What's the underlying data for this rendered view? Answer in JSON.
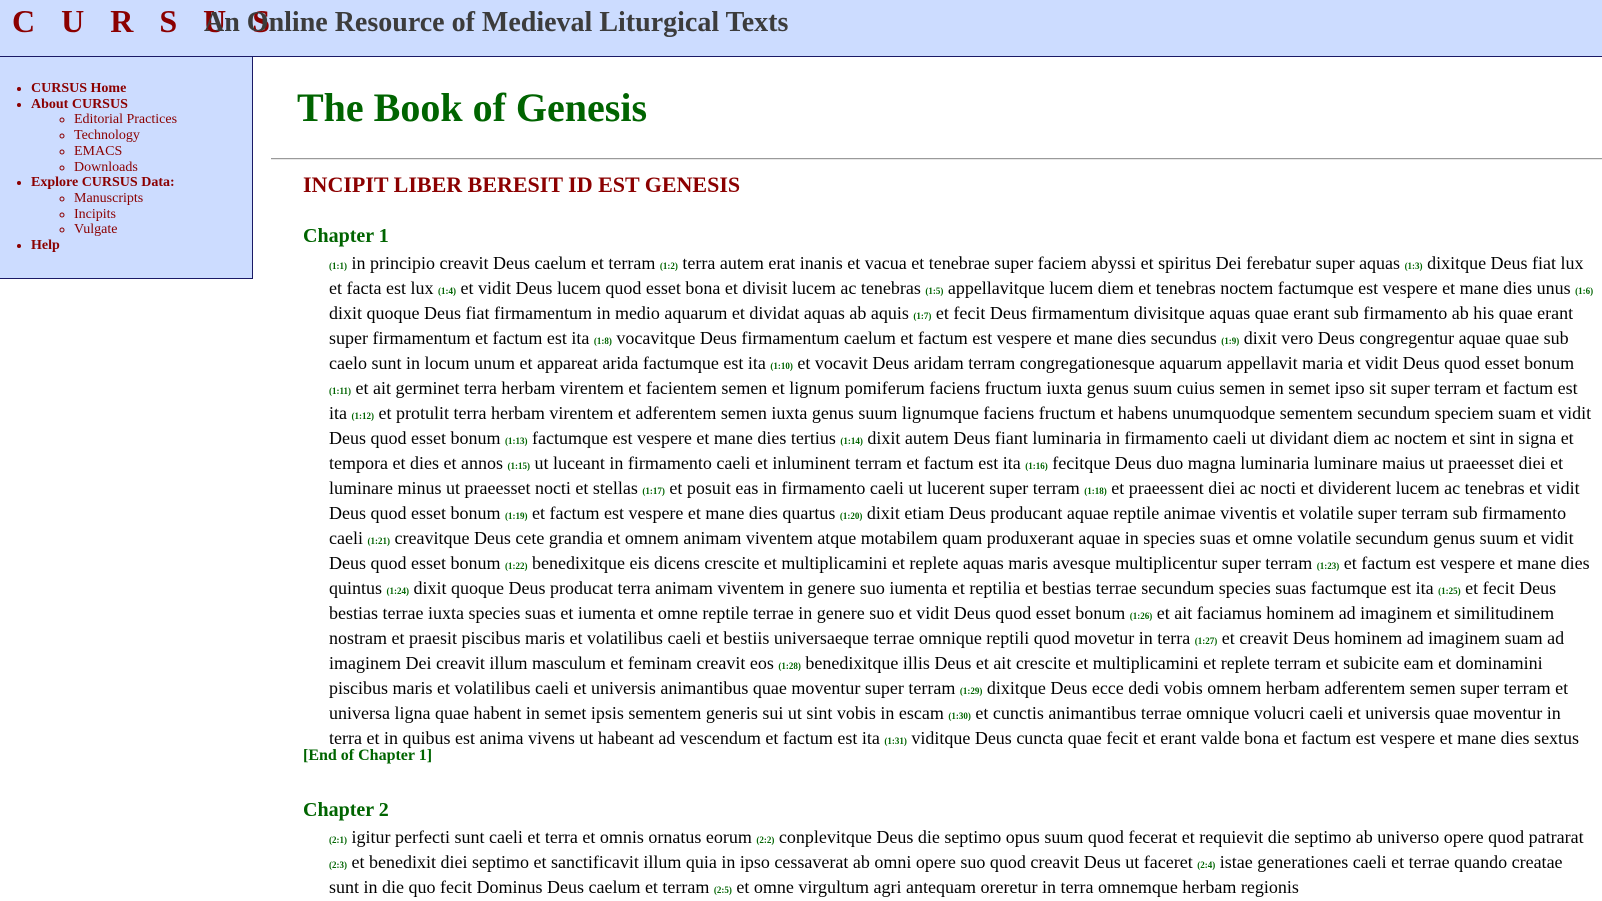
{
  "header": {
    "brand": "C U R S U S",
    "subtitle": "An Online Resource of Medieval Liturgical Texts"
  },
  "sidebar": {
    "items": [
      {
        "label": "CURSUS Home"
      },
      {
        "label": "About CURSUS",
        "children": [
          "Editorial Practices",
          "Technology",
          "EMACS",
          "Downloads"
        ]
      },
      {
        "label": "Explore CURSUS Data:",
        "children": [
          "Manuscripts",
          "Incipits",
          "Vulgate"
        ]
      },
      {
        "label": "Help"
      }
    ]
  },
  "page": {
    "title": "The Book of Genesis",
    "incipit": "INCIPIT LIBER BERESIT ID EST GENESIS"
  },
  "chapters": [
    {
      "heading": "Chapter 1",
      "end_label": "[End of Chapter 1]",
      "verses": [
        {
          "n": "(1:1)",
          "t": "in principio creavit Deus caelum et terram"
        },
        {
          "n": "(1:2)",
          "t": "terra autem erat inanis et vacua et tenebrae super faciem abyssi et spiritus Dei ferebatur super aquas"
        },
        {
          "n": "(1:3)",
          "t": "dixitque Deus fiat lux et facta est lux"
        },
        {
          "n": "(1:4)",
          "t": "et vidit Deus lucem quod esset bona et divisit lucem ac tenebras"
        },
        {
          "n": "(1:5)",
          "t": "appellavitque lucem diem et tenebras noctem factumque est vespere et mane dies unus"
        },
        {
          "n": "(1:6)",
          "t": "dixit quoque Deus fiat firmamentum in medio aquarum et dividat aquas ab aquis"
        },
        {
          "n": "(1:7)",
          "t": "et fecit Deus firmamentum divisitque aquas quae erant sub firmamento ab his quae erant super firmamentum et factum est ita"
        },
        {
          "n": "(1:8)",
          "t": "vocavitque Deus firmamentum caelum et factum est vespere et mane dies secundus"
        },
        {
          "n": "(1:9)",
          "t": "dixit vero Deus congregentur aquae quae sub caelo sunt in locum unum et appareat arida factumque est ita"
        },
        {
          "n": "(1:10)",
          "t": "et vocavit Deus aridam terram congregationesque aquarum appellavit maria et vidit Deus quod esset bonum"
        },
        {
          "n": "(1:11)",
          "t": "et ait germinet terra herbam virentem et facientem semen et lignum pomiferum faciens fructum iuxta genus suum cuius semen in semet ipso sit super terram et factum est ita"
        },
        {
          "n": "(1:12)",
          "t": "et protulit terra herbam virentem et adferentem semen iuxta genus suum lignumque faciens fructum et habens unumquodque sementem secundum speciem suam et vidit Deus quod esset bonum"
        },
        {
          "n": "(1:13)",
          "t": "factumque est vespere et mane dies tertius"
        },
        {
          "n": "(1:14)",
          "t": "dixit autem Deus fiant luminaria in firmamento caeli ut dividant diem ac noctem et sint in signa et tempora et dies et annos"
        },
        {
          "n": "(1:15)",
          "t": "ut luceant in firmamento caeli et inluminent terram et factum est ita"
        },
        {
          "n": "(1:16)",
          "t": "fecitque Deus duo magna luminaria luminare maius ut praeesset diei et luminare minus ut praeesset nocti et stellas"
        },
        {
          "n": "(1:17)",
          "t": "et posuit eas in firmamento caeli ut lucerent super terram"
        },
        {
          "n": "(1:18)",
          "t": "et praeessent diei ac nocti et dividerent lucem ac tenebras et vidit Deus quod esset bonum"
        },
        {
          "n": "(1:19)",
          "t": "et factum est vespere et mane dies quartus"
        },
        {
          "n": "(1:20)",
          "t": "dixit etiam Deus producant aquae reptile animae viventis et volatile super terram sub firmamento caeli"
        },
        {
          "n": "(1:21)",
          "t": "creavitque Deus cete grandia et omnem animam viventem atque motabilem quam produxerant aquae in species suas et omne volatile secundum genus suum et vidit Deus quod esset bonum"
        },
        {
          "n": "(1:22)",
          "t": "benedixitque eis dicens crescite et multiplicamini et replete aquas maris avesque multiplicentur super terram"
        },
        {
          "n": "(1:23)",
          "t": "et factum est vespere et mane dies quintus"
        },
        {
          "n": "(1:24)",
          "t": "dixit quoque Deus producat terra animam viventem in genere suo iumenta et reptilia et bestias terrae secundum species suas factumque est ita"
        },
        {
          "n": "(1:25)",
          "t": "et fecit Deus bestias terrae iuxta species suas et iumenta et omne reptile terrae in genere suo et vidit Deus quod esset bonum"
        },
        {
          "n": "(1:26)",
          "t": "et ait faciamus hominem ad imaginem et similitudinem nostram et praesit piscibus maris et volatilibus caeli et bestiis universaeque terrae omnique reptili quod movetur in terra"
        },
        {
          "n": "(1:27)",
          "t": "et creavit Deus hominem ad imaginem suam ad imaginem Dei creavit illum masculum et feminam creavit eos"
        },
        {
          "n": "(1:28)",
          "t": "benedixitque illis Deus et ait crescite et multiplicamini et replete terram et subicite eam et dominamini piscibus maris et volatilibus caeli et universis animantibus quae moventur super terram"
        },
        {
          "n": "(1:29)",
          "t": "dixitque Deus ecce dedi vobis omnem herbam adferentem semen super terram et universa ligna quae habent in semet ipsis sementem generis sui ut sint vobis in escam"
        },
        {
          "n": "(1:30)",
          "t": "et cunctis animantibus terrae omnique volucri caeli et universis quae moventur in terra et in quibus est anima vivens ut habeant ad vescendum et factum est ita"
        },
        {
          "n": "(1:31)",
          "t": "viditque Deus cuncta quae fecit et erant valde bona et factum est vespere et mane dies sextus"
        }
      ]
    },
    {
      "heading": "Chapter 2",
      "end_label": "",
      "verses": [
        {
          "n": "(2:1)",
          "t": "igitur perfecti sunt caeli et terra et omnis ornatus eorum"
        },
        {
          "n": "(2:2)",
          "t": "conplevitque Deus die septimo opus suum quod fecerat et requievit die septimo ab universo opere quod patrarat"
        },
        {
          "n": "(2:3)",
          "t": "et benedixit diei septimo et sanctificavit illum quia in ipso cessaverat ab omni opere suo quod creavit Deus ut faceret"
        },
        {
          "n": "(2:4)",
          "t": "istae generationes caeli et terrae quando creatae sunt in die quo fecit Dominus Deus caelum et terram"
        },
        {
          "n": "(2:5)",
          "t": "et omne virgultum agri antequam oreretur in terra omnemque herbam regionis"
        }
      ]
    }
  ]
}
